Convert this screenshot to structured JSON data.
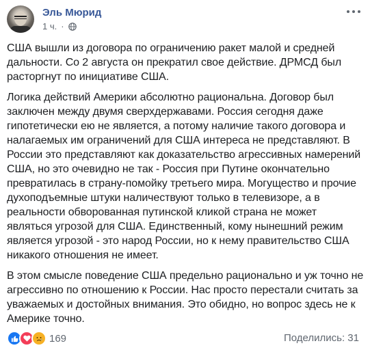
{
  "post": {
    "author": "Эль Мюрид",
    "timestamp": "1 ч.",
    "privacy_icon": "globe-icon",
    "paragraphs": [
      "США вышли из договора по ограничению ракет малой и средней дальности. Со 2 августа он прекратил свое действие. ДРМСД был расторгнут по инициативе США.",
      "Логика действий Америки абсолютно рациональна. Договор был заключен между двумя сверхдержавами. Россия сегодня даже гипотетически ею не является, а потому наличие такого договора и налагаемых им ограничений для США интереса не представляют. В России это представляют как доказательство агрессивных намерений США, но это очевидно не так - Россия при Путине окончательно превратилась в страну-помойку третьего мира. Могущество и прочие духоподъемные штуки наличествуют только в телевизоре, а в реальности обворованная путинской кликой страна не может являться угрозой для США. Единственный, кому нынешний режим является угрозой - это народ России, но к нему правительство США никакого отношения не имеет.",
      "В этом смысле поведение США предельно рационально и уж точно не агрессивно по отношению к России. Нас просто перестали считать за уважаемых и достойных внимания. Это обидно, но вопрос здесь не к Америке точно."
    ]
  },
  "footer": {
    "reaction_icons": [
      "like-icon",
      "love-icon",
      "sad-icon"
    ],
    "reaction_count": "169",
    "shares": "Поделились: 31"
  },
  "colors": {
    "author_link": "#385898",
    "meta_text": "#606770",
    "body_text": "#1c1e21"
  }
}
